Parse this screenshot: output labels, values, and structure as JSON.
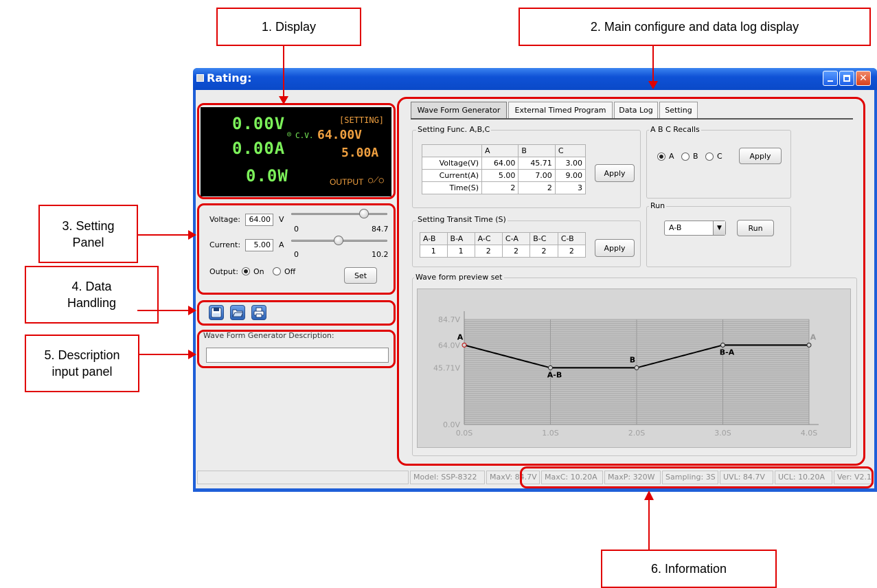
{
  "callouts": {
    "display": "1. Display",
    "main": "2. Main configure and data log display",
    "setting_panel": "3. Setting Panel",
    "data_handling": "4. Data Handling",
    "description": "5. Description input panel",
    "information": "6. Information"
  },
  "window": {
    "title": "Rating:"
  },
  "display": {
    "voltage": "0.00V",
    "current": "0.00A",
    "power": "0.0W",
    "setting_tag": "[SETTING]",
    "mode": "C.V.",
    "set_voltage": "64.00V",
    "set_current": "5.00A",
    "output_label": "OUTPUT"
  },
  "setting_panel": {
    "voltage_label": "Voltage:",
    "voltage_value": "64.00",
    "voltage_unit": "V",
    "voltage_min": "0",
    "voltage_max": "84.7",
    "voltage_slider_level": 0.756,
    "current_label": "Current:",
    "current_value": "5.00",
    "current_unit": "A",
    "current_min": "0",
    "current_max": "10.2",
    "current_slider_level": 0.49,
    "output_label": "Output:",
    "on_label": "On",
    "off_label": "Off",
    "output_selected": "On",
    "set_label": "Set"
  },
  "data_handling": {
    "icons": [
      "save-icon",
      "open-folder-icon",
      "print-icon"
    ]
  },
  "description": {
    "label": "Wave Form Generator Description:",
    "value": ""
  },
  "tabs": [
    {
      "label": "Wave Form Generator",
      "selected": true
    },
    {
      "label": "External Timed Program",
      "selected": false
    },
    {
      "label": "Data Log",
      "selected": false
    },
    {
      "label": "Setting",
      "selected": false
    }
  ],
  "setting_func": {
    "title": "Setting Func. A,B,C",
    "columns": [
      "",
      "A",
      "B",
      "C"
    ],
    "rows": [
      [
        "Voltage(V)",
        "64.00",
        "45.71",
        "3.00"
      ],
      [
        "Current(A)",
        "5.00",
        "7.00",
        "9.00"
      ],
      [
        "Time(S)",
        "2",
        "2",
        "3"
      ]
    ],
    "apply_label": "Apply"
  },
  "recalls": {
    "title": "A B C Recalls",
    "options": [
      "A",
      "B",
      "C"
    ],
    "selected": "A",
    "apply_label": "Apply"
  },
  "transit": {
    "title": "Setting Transit Time (S)",
    "columns": [
      "A-B",
      "B-A",
      "A-C",
      "C-A",
      "B-C",
      "C-B"
    ],
    "values": [
      "1",
      "1",
      "2",
      "2",
      "2",
      "2"
    ],
    "apply_label": "Apply"
  },
  "run": {
    "title": "Run",
    "selected_option": "A-B",
    "run_label": "Run"
  },
  "preview": {
    "title": "Wave form preview set"
  },
  "chart_data": {
    "type": "line",
    "x": [
      0.0,
      1.0,
      2.0,
      3.0,
      4.0
    ],
    "series": [
      {
        "values": [
          64.0,
          45.71,
          45.71,
          64.0,
          64.0
        ]
      }
    ],
    "point_labels": [
      "A",
      "A-B",
      "B",
      "B-A",
      "A"
    ],
    "ytick_labels": [
      "84.7V",
      "64.0V",
      "45.71V",
      "0.0V"
    ],
    "yticks": [
      84.7,
      64.0,
      45.71,
      0.0
    ],
    "xtick_labels": [
      "0.0S",
      "1.0S",
      "2.0S",
      "3.0S",
      "4.0S"
    ],
    "xlim": [
      0,
      4
    ],
    "ylim": [
      0,
      84.7
    ],
    "grid": true,
    "line_color": "#000000"
  },
  "status_bar": [
    "",
    "Model: SSP-8322",
    "MaxV: 84.7V",
    "MaxC: 10.20A",
    "MaxP: 320W",
    "Sampling: 3S",
    "UVL: 84.7V",
    "UCL: 10.20A",
    "Ver: V2.1"
  ],
  "colors": {
    "annotation_red": "#e00000",
    "lcd_green": "#7cf25a",
    "lcd_orange": "#f0a040",
    "titlebar_blue": "#0f52d6"
  }
}
